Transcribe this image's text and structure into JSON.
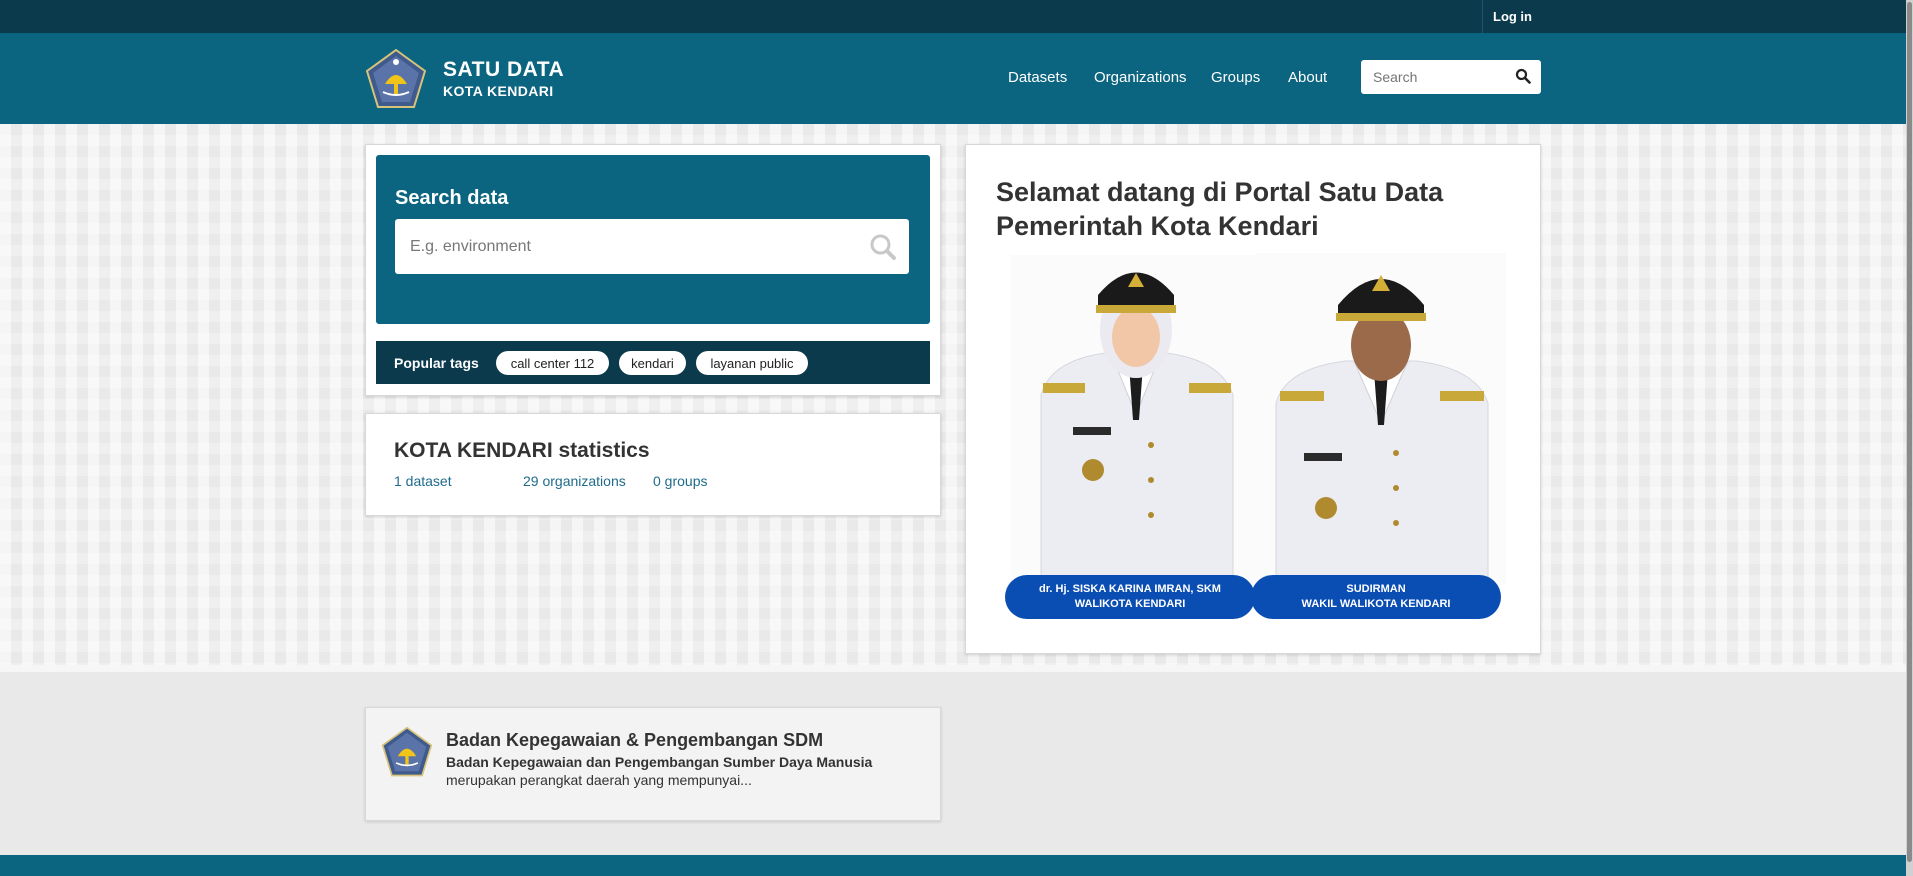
{
  "account": {
    "login_label": "Log in"
  },
  "site": {
    "title": "SATU DATA",
    "subtitle": "KOTA KENDARI"
  },
  "nav": {
    "items": [
      "Datasets",
      "Organizations",
      "Groups",
      "About"
    ],
    "search_placeholder": "Search"
  },
  "search_module": {
    "heading": "Search data",
    "placeholder": "E.g. environment"
  },
  "popular_tags": {
    "label": "Popular tags",
    "tags": [
      "call center 112",
      "kendari",
      "layanan public"
    ]
  },
  "stats": {
    "title": "KOTA KENDARI statistics",
    "datasets": "1 dataset",
    "organizations": "29 organizations",
    "groups": "0 groups"
  },
  "welcome": {
    "title": "Selamat datang di Portal Satu Data Pemerintah Kota Kendari",
    "officials": [
      {
        "name": "dr. Hj. SISKA KARINA IMRAN, SKM",
        "role": "WALIKOTA KENDARI"
      },
      {
        "name": "SUDIRMAN",
        "role": "WAKIL WALIKOTA KENDARI"
      }
    ]
  },
  "organization": {
    "name": "Badan Kepegawaian & Pengembangan SDM",
    "description_bold": "Badan Kepegawaian dan Pengembangan Sumber Daya Manusia",
    "description": "merupakan perangkat daerah yang mempunyai..."
  },
  "colors": {
    "primary": "#0b6480",
    "dark": "#0a3a4c",
    "pill": "#0a4eb3",
    "link": "#1f6b8a"
  }
}
